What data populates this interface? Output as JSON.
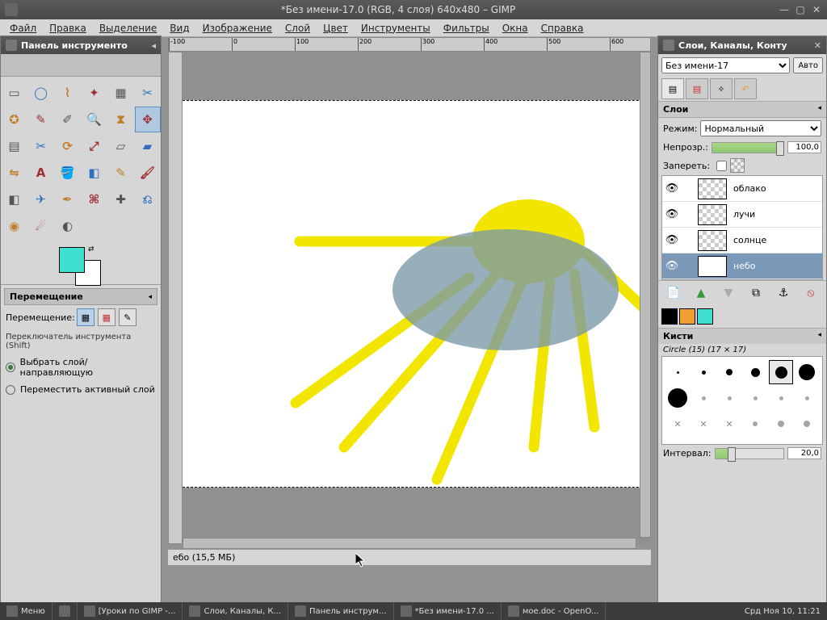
{
  "window": {
    "title": "*Без имени-17.0 (RGB, 4 слоя) 640x480 – GIMP"
  },
  "menu": {
    "file": "Файл",
    "edit": "Правка",
    "select": "Выделение",
    "view": "Вид",
    "image": "Изображение",
    "layer": "Слой",
    "colors": "Цвет",
    "tools": "Инструменты",
    "filters": "Фильтры",
    "windows": "Окна",
    "help": "Справка"
  },
  "ruler": {
    "ticks": [
      "-100",
      "0",
      "100",
      "200",
      "300",
      "400",
      "500",
      "600"
    ]
  },
  "toolbox": {
    "title": "Панель инструменто",
    "opts_title": "Перемещение",
    "move_label": "Перемещение:",
    "switch_label": "Переключатель инструмента  (Shift)",
    "radio1": "Выбрать слой/направляющую",
    "radio2": "Переместить активный слой",
    "fg": "#40e0d0",
    "bg": "#ffffff"
  },
  "layers_dock": {
    "title": "Слои, Каналы, Конту",
    "image_sel": "Без имени-17",
    "auto": "Авто",
    "section": "Слои",
    "mode_label": "Режим:",
    "mode_value": "Нормальный",
    "opacity_label": "Непрозр.:",
    "opacity_value": "100,0",
    "lock_label": "Запереть:",
    "layers": [
      {
        "name": "облако",
        "visible": true,
        "sky": false
      },
      {
        "name": "лучи",
        "visible": true,
        "sky": false
      },
      {
        "name": "солнце",
        "visible": true,
        "sky": false
      },
      {
        "name": "небо",
        "visible": true,
        "sky": true
      }
    ],
    "mini_colors": [
      "#000000",
      "#f0a030",
      "#40e0d0"
    ],
    "brushes_title": "Кисти",
    "brush_name": "Circle (15) (17 × 17)",
    "interval_label": "Интервал:",
    "interval_value": "20,0"
  },
  "status": {
    "text": "ебо (15,5 МБ)"
  },
  "taskbar": {
    "menu": "Меню",
    "items": [
      "[Уроки по GIMP -...",
      "Слои, Каналы, К...",
      "Панель инструм...",
      "*Без имени-17.0 ...",
      "мое.doc - OpenO..."
    ],
    "clock": "Срд Ноя 10, 11:21"
  }
}
